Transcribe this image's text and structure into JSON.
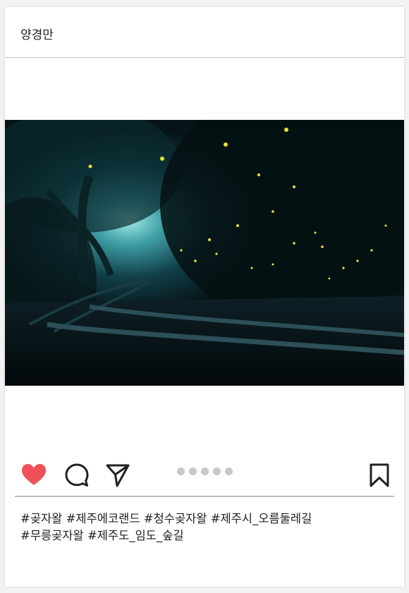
{
  "post": {
    "username": "양경만",
    "photo_alt": "청수곶자왈 숲길 철길과 반딧불이",
    "carousel": {
      "count": 5,
      "active": 0
    },
    "hashtags": [
      "#곶자왈 #제주에코랜드 #청수곶자왈 #제주시_오름둘레길",
      "#무릉곶자왈 #제주도_임도_숲길"
    ]
  },
  "icons": {
    "like": "heart-icon",
    "comment": "comment-bubble-icon",
    "share": "paper-plane-icon",
    "save": "bookmark-icon"
  },
  "colors": {
    "like_active": "#f0505a",
    "icon_stroke": "#222222",
    "divider": "#bdbdbd",
    "dot_inactive": "#c8c8c8"
  }
}
